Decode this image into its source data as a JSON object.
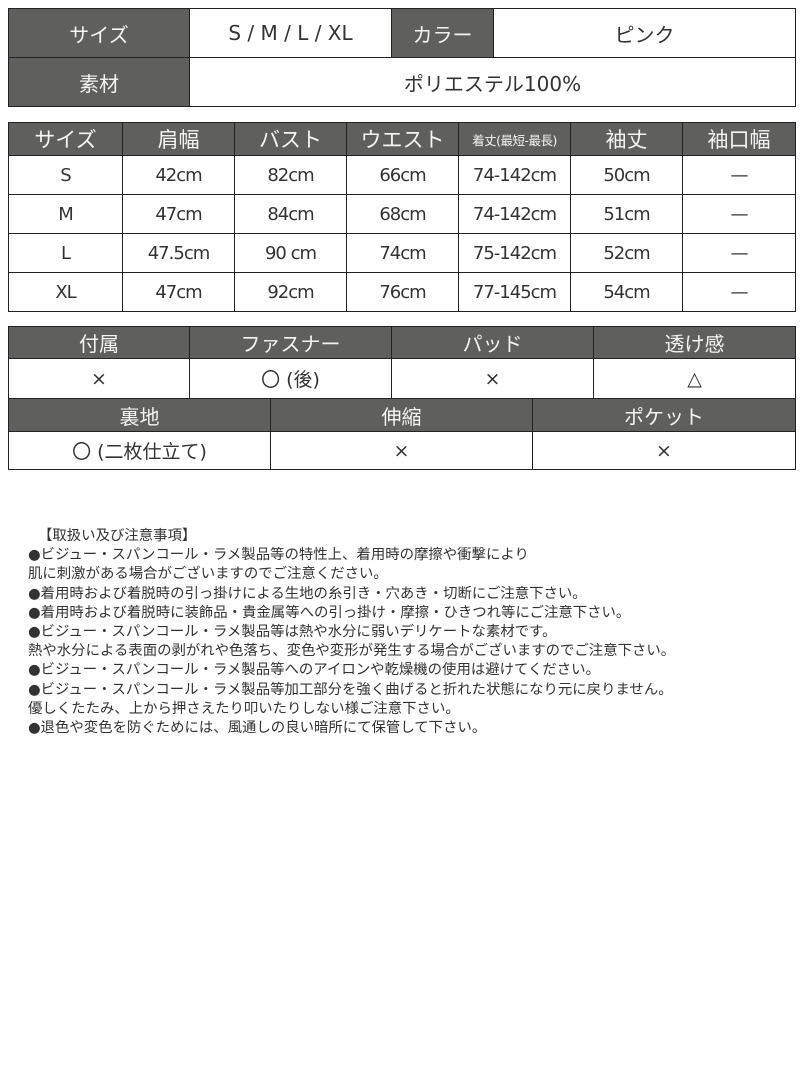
{
  "summary": {
    "size_label": "サイズ",
    "size_value": "S / M / L / XL",
    "color_label": "カラー",
    "color_value": "ピンク",
    "material_label": "素材",
    "material_value": "ポリエステル100%"
  },
  "measurements": {
    "headers": [
      "サイズ",
      "肩幅",
      "バスト",
      "ウエスト",
      "着丈(最短-最長)",
      "袖丈",
      "袖口幅"
    ],
    "rows": [
      [
        "S",
        "42cm",
        "82cm",
        "66cm",
        "74-142cm",
        "50cm",
        "—"
      ],
      [
        "M",
        "47cm",
        "84cm",
        "68cm",
        "74-142cm",
        "51cm",
        "—"
      ],
      [
        "L",
        "47.5cm",
        "90 cm",
        "74cm",
        "75-142cm",
        "52cm",
        "—"
      ],
      [
        "XL",
        "47cm",
        "92cm",
        "76cm",
        "77-145cm",
        "54cm",
        "—"
      ]
    ]
  },
  "features_1": {
    "headers": [
      "付属",
      "ファスナー",
      "パッド",
      "透け感"
    ],
    "values": [
      "×",
      "〇 (後)",
      "×",
      "△"
    ]
  },
  "features_2": {
    "headers": [
      "裏地",
      "伸縮",
      "ポケット"
    ],
    "values": [
      "〇 (二枚仕立て)",
      "×",
      "×"
    ]
  },
  "notes": {
    "title": "【取扱い及び注意事項】",
    "lines": [
      "●ビジュー・スパンコール・ラメ製品等の特性上、着用時の摩擦や衝撃により",
      "肌に刺激がある場合がございますのでご注意ください。",
      "●着用時および着脱時の引っ掛けによる生地の糸引き・穴あき・切断にご注意下さい。",
      "●着用時および着脱時に装飾品・貴金属等への引っ掛け・摩擦・ひきつれ等にご注意下さい。",
      "●ビジュー・スパンコール・ラメ製品等は熱や水分に弱いデリケートな素材です。",
      "熱や水分による表面の剥がれや色落ち、変色や変形が発生する場合がございますのでご注意下さい。",
      "●ビジュー・スパンコール・ラメ製品等へのアイロンや乾燥機の使用は避けてください。",
      "●ビジュー・スパンコール・ラメ製品等加工部分を強く曲げると折れた状態になり元に戻りません。",
      "優しくたたみ、上から押さえたり叩いたりしない様ご注意下さい。",
      "●退色や変色を防ぐためには、風通しの良い暗所にて保管して下さい。"
    ]
  }
}
